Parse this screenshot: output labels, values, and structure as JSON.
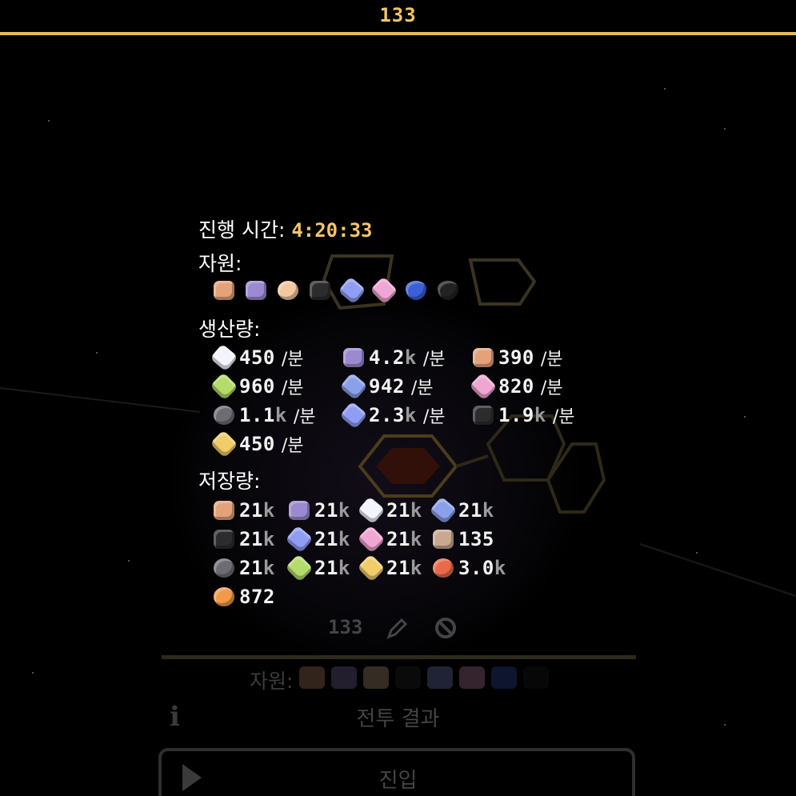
{
  "header": {
    "title": "133"
  },
  "tooltip": {
    "time_label": "진행 시간:",
    "time_value": "4:20:33",
    "resources_label": "자원:",
    "resources": [
      {
        "icon": "copper-ingot-icon",
        "color": "#e4a27a"
      },
      {
        "icon": "purple-ingot-icon",
        "color": "#9c8ad0"
      },
      {
        "icon": "beige-ore-icon",
        "color": "#f2c8a0"
      },
      {
        "icon": "coal-icon",
        "color": "#2c2c2c"
      },
      {
        "icon": "blue-crystal-icon",
        "color": "#8f9ef2"
      },
      {
        "icon": "heart-gem-icon",
        "color": "#f0a6d2"
      },
      {
        "icon": "blue-drop-icon",
        "color": "#3b5fd6"
      },
      {
        "icon": "black-drop-icon",
        "color": "#222222"
      }
    ],
    "production_label": "생산량:",
    "production": [
      {
        "icon": "white-crystal-icon",
        "color": "#f4f4ff",
        "value": "450",
        "suffix": "",
        "unit": "/분"
      },
      {
        "icon": "purple-ingot-icon",
        "color": "#9c8ad0",
        "value": "4.2",
        "suffix": "k",
        "unit": "/분"
      },
      {
        "icon": "copper-ingot-icon",
        "color": "#e4a27a",
        "value": "390",
        "suffix": "",
        "unit": "/분"
      },
      {
        "icon": "green-gem-icon",
        "color": "#b4dc6a",
        "value": "960",
        "suffix": "",
        "unit": "/분"
      },
      {
        "icon": "blue-block-icon",
        "color": "#8aa0e8",
        "value": "942",
        "suffix": "",
        "unit": "/분"
      },
      {
        "icon": "heart-gem-icon",
        "color": "#f0a6d2",
        "value": "820",
        "suffix": "",
        "unit": "/분"
      },
      {
        "icon": "gray-ore-icon",
        "color": "#6c6c74",
        "value": "1.1",
        "suffix": "k",
        "unit": "/분"
      },
      {
        "icon": "blue-crystal-icon",
        "color": "#8f9ef2",
        "value": "2.3",
        "suffix": "k",
        "unit": "/분"
      },
      {
        "icon": "coal-icon",
        "color": "#2c2c2c",
        "value": "1.9",
        "suffix": "k",
        "unit": "/분"
      },
      {
        "icon": "gold-gem-icon",
        "color": "#f0cc6a",
        "value": "450",
        "suffix": "",
        "unit": "/분"
      }
    ],
    "storage_label": "저장량:",
    "storage": [
      {
        "icon": "copper-ingot-icon",
        "color": "#e4a27a",
        "value": "21",
        "suffix": "k"
      },
      {
        "icon": "purple-ingot-icon",
        "color": "#9c8ad0",
        "value": "21",
        "suffix": "k"
      },
      {
        "icon": "white-crystal-icon",
        "color": "#f4f4ff",
        "value": "21",
        "suffix": "k"
      },
      {
        "icon": "blue-block-icon",
        "color": "#8aa0e8",
        "value": "21",
        "suffix": "k"
      },
      {
        "icon": "coal-icon",
        "color": "#2c2c2c",
        "value": "21",
        "suffix": "k"
      },
      {
        "icon": "blue-crystal-icon",
        "color": "#8f9ef2",
        "value": "21",
        "suffix": "k"
      },
      {
        "icon": "heart-gem-icon",
        "color": "#f0a6d2",
        "value": "21",
        "suffix": "k"
      },
      {
        "icon": "bandage-icon",
        "color": "#c8a890",
        "value": "135",
        "suffix": ""
      },
      {
        "icon": "gray-ore-icon",
        "color": "#6c6c74",
        "value": "21",
        "suffix": "k"
      },
      {
        "icon": "green-gem-icon",
        "color": "#b4dc6a",
        "value": "21",
        "suffix": "k"
      },
      {
        "icon": "gold-gem-icon",
        "color": "#f0cc6a",
        "value": "21",
        "suffix": "k"
      },
      {
        "icon": "red-orb-icon",
        "color": "#e86a4a",
        "value": "3.0",
        "suffix": "k"
      },
      {
        "icon": "orange-orb-icon",
        "color": "#f09a4a",
        "value": "872",
        "suffix": ""
      }
    ]
  },
  "panel": {
    "name": "133",
    "resources_label": "자원:",
    "battle_result": "전투 결과",
    "enter": "진입"
  }
}
